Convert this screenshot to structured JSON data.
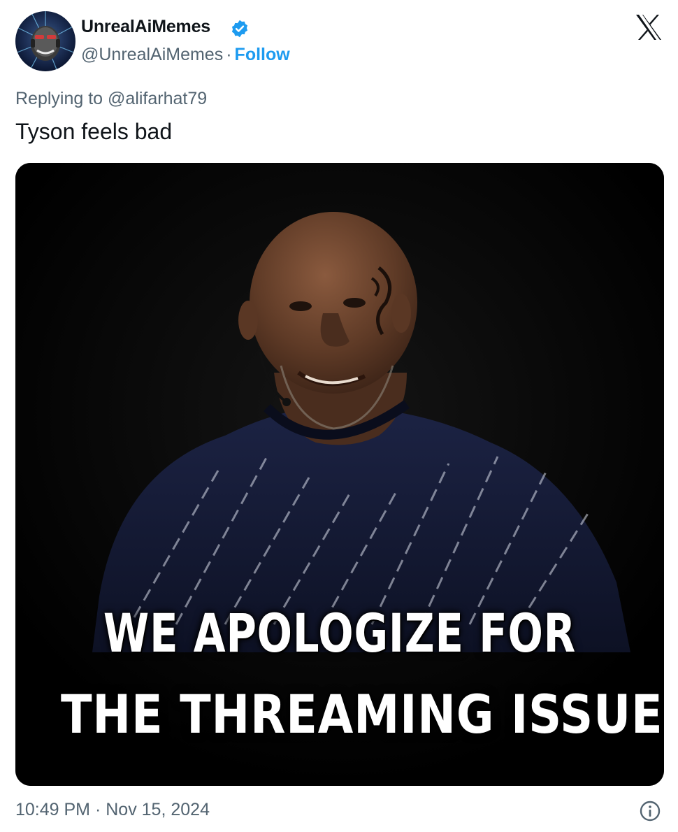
{
  "author": {
    "display_name": "UnrealAiMemes",
    "handle": "@UnrealAiMemes",
    "separator": "·",
    "follow_label": "Follow",
    "avatar_icon": "robot-face-avatar",
    "verified_icon": "verified-badge-icon"
  },
  "reply": {
    "prefix": "Replying to",
    "mention": "@alifarhat79"
  },
  "tweet_text": "Tyson feels bad",
  "media": {
    "caption_line_1": "WE APOLOGIZE FOR",
    "caption_line_2": "THE THREAMING ISSUE"
  },
  "footer": {
    "time": "10:49 PM",
    "separator": "·",
    "date": "Nov 15, 2024",
    "info_icon": "info-icon"
  },
  "colors": {
    "accent": "#1d9bf0",
    "text_primary": "#0f1419",
    "text_secondary": "#536471",
    "background": "#ffffff"
  }
}
